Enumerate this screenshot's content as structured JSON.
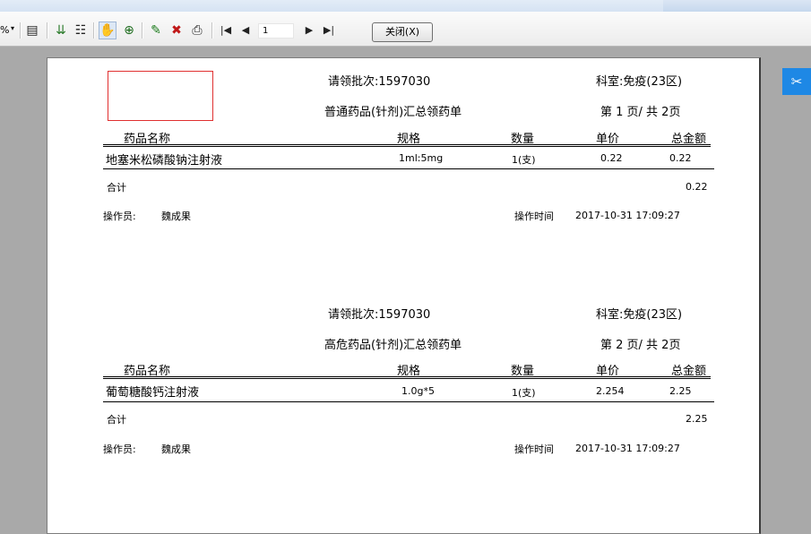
{
  "toolbar": {
    "zoom_suffix": "%",
    "page_number": "1",
    "close_label": "关闭(X)"
  },
  "icons": [
    "zoom-dropdown-icon",
    "single-page-icon",
    "export-icon",
    "tree-icon",
    "hand-tool-icon",
    "zoom-in-icon",
    "edit-icon",
    "delete-icon",
    "print-icon",
    "first-page-icon",
    "prev-page-icon",
    "next-page-icon",
    "last-page-icon",
    "side-panel-icon"
  ],
  "reports": [
    {
      "batch": "请领批次:1597030",
      "department": "科室:免疫(23区)",
      "title": "普通药品(针剂)汇总领药单",
      "page_info": "第 1 页/ 共 2页",
      "headers": [
        "药品名称",
        "规格",
        "数量",
        "单价",
        "总金额"
      ],
      "rows": [
        [
          "地塞米松磷酸钠注射液",
          "1ml:5mg",
          "1(支)",
          "0.22",
          "0.22"
        ]
      ],
      "total_label": "合计",
      "total_value": "0.22",
      "operator_label": "操作员:",
      "operator_name": "魏成果",
      "time_label": "操作时间",
      "time_value": "2017-10-31 17:09:27"
    },
    {
      "batch": "请领批次:1597030",
      "department": "科室:免疫(23区)",
      "title": "高危药品(针剂)汇总领药单",
      "page_info": "第 2 页/ 共 2页",
      "headers": [
        "药品名称",
        "规格",
        "数量",
        "单价",
        "总金额"
      ],
      "rows": [
        [
          "葡萄糖酸钙注射液",
          "1.0g*5",
          "1(支)",
          "2.254",
          "2.25"
        ]
      ],
      "total_label": "合计",
      "total_value": "2.25",
      "operator_label": "操作员:",
      "operator_name": "魏成果",
      "time_label": "操作时间",
      "time_value": "2017-10-31 17:09:27"
    }
  ],
  "colors": {
    "accent": "#1e88e5",
    "stamp_border": "#e03030",
    "background": "#a9a9a9"
  }
}
